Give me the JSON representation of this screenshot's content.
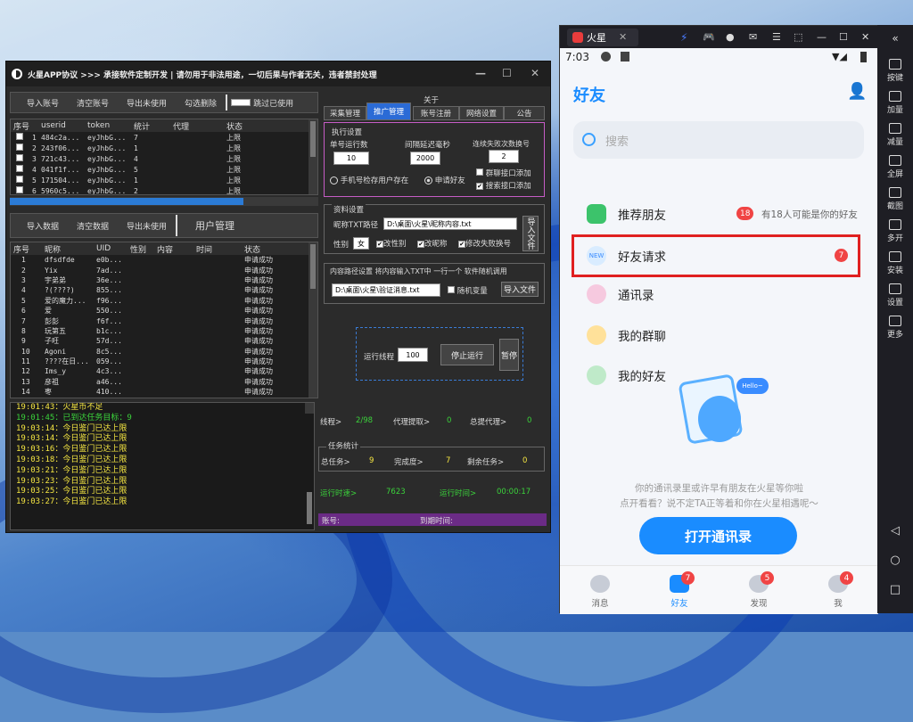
{
  "app": {
    "title": "火星APP协议  >>>  承接软件定制开发  |  请勿用于非法用途，一切后果与作者无关，违者禁封处理"
  },
  "toolbar1": [
    "导入账号",
    "清空账号",
    "导出未使用",
    "勾选删除"
  ],
  "skip_used": "跳过已使用",
  "acct_cols": [
    "序号",
    "userid",
    "token",
    "统计",
    "代理",
    "状态"
  ],
  "acct_rows": [
    [
      "1",
      "484c2a...",
      "eyJhbG...",
      "7",
      "",
      "上限"
    ],
    [
      "2",
      "243f06...",
      "eyJhbG...",
      "1",
      "",
      "上限"
    ],
    [
      "3",
      "721c43...",
      "eyJhbG...",
      "4",
      "",
      "上限"
    ],
    [
      "4",
      "041f1f...",
      "eyJhbG...",
      "5",
      "",
      "上限"
    ],
    [
      "5",
      "171504...",
      "eyJhbG...",
      "1",
      "",
      "上限"
    ],
    [
      "6",
      "5960c5...",
      "eyJhbG...",
      "2",
      "",
      "上限"
    ]
  ],
  "toolbar2": [
    "导入数据",
    "清空数据",
    "导出未使用"
  ],
  "user_mgmt": "用户管理",
  "user_cols": [
    "序号",
    "昵称",
    "UID",
    "性别",
    "内容",
    "时间",
    "状态"
  ],
  "user_rows": [
    [
      "1",
      "dfsdfde",
      "e0b...",
      "申请成功"
    ],
    [
      "2",
      "Yix",
      "7ad...",
      "申请成功"
    ],
    [
      "3",
      "宇弟弟",
      "36e...",
      "申请成功"
    ],
    [
      "4",
      "?(????)",
      "855...",
      "申请成功"
    ],
    [
      "5",
      "爱的魔力...",
      "f96...",
      "申请成功"
    ],
    [
      "6",
      "爱",
      "550...",
      "申请成功"
    ],
    [
      "7",
      "彭彭",
      "f6f...",
      "申请成功"
    ],
    [
      "8",
      "玩第五",
      "b1c...",
      "申请成功"
    ],
    [
      "9",
      "子旺",
      "57d...",
      "申请成功"
    ],
    [
      "10",
      "Agoni",
      "8c5...",
      "申请成功"
    ],
    [
      "11",
      "????在日...",
      "059...",
      "申请成功"
    ],
    [
      "12",
      "Ims_y",
      "4c3...",
      "申请成功"
    ],
    [
      "13",
      "彦祖",
      "a46...",
      "申请成功"
    ],
    [
      "14",
      "枣",
      "410...",
      "申请成功"
    ]
  ],
  "log": [
    {
      "t": "19:01:43",
      "m": "火星币不足",
      "c": "#f5e642"
    },
    {
      "t": "19:01:45",
      "m": "已到达任务目标：9",
      "c": "#3bd23b"
    },
    {
      "t": "19:03:14",
      "m": "今日鉴门已达上限",
      "c": "#f5e642"
    },
    {
      "t": "19:03:14",
      "m": "今日鉴门已达上限",
      "c": "#f5e642"
    },
    {
      "t": "19:03:16",
      "m": "今日鉴门已达上限",
      "c": "#f5e642"
    },
    {
      "t": "19:03:18",
      "m": "今日鉴门已达上限",
      "c": "#f5e642"
    },
    {
      "t": "19:03:21",
      "m": "今日鉴门已达上限",
      "c": "#f5e642"
    },
    {
      "t": "19:03:23",
      "m": "今日鉴门已达上限",
      "c": "#f5e642"
    },
    {
      "t": "19:03:25",
      "m": "今日鉴门已达上限",
      "c": "#f5e642"
    },
    {
      "t": "19:03:27",
      "m": "今日鉴门已达上限",
      "c": "#f5e642"
    }
  ],
  "tabs": {
    "about": "关于",
    "items": [
      "采集管理",
      "推广管理",
      "账号注册",
      "网络设置",
      "公告"
    ]
  },
  "exec": {
    "title": "执行设置",
    "single_count_label": "单号运行数",
    "single_count": "10",
    "interval_label": "间隔延迟毫秒",
    "interval": "2000",
    "fail_label": "连续失败次数换号",
    "fail": "2",
    "opt1": "手机号检存用户存在",
    "opt2": "申请好友",
    "chk1": "群聊接口添加",
    "chk2": "搜索接口添加"
  },
  "profile": {
    "title": "资料设置",
    "txt_label": "昵称TXT路径",
    "txt_path": "D:\\桌面\\火星\\昵称内容.txt",
    "import": "导入文件",
    "gender_label": "性别",
    "gender": "女",
    "c1": "改性别",
    "c2": "改昵称",
    "c3": "修改失败换号"
  },
  "content": {
    "title": "内容路径设置  将内容输入TXT中  一行一个  软件随机调用",
    "path": "D:\\桌面\\火星\\验证消息.txt",
    "rand": "随机变量",
    "import": "导入文件"
  },
  "run": {
    "threads_label": "运行线程",
    "threads": "100",
    "stop": "停止运行",
    "pause": "暂停"
  },
  "stats": {
    "thread_label": "线程>",
    "thread_val": "2/98",
    "proxy_label": "代理提取>",
    "proxy_val": "0",
    "total_proxy_label": "总提代理>",
    "total_proxy_val": "0",
    "group_title": "任务统计",
    "task_label": "总任务>",
    "task_val": "9",
    "done_label": "完成度>",
    "done_val": "7",
    "left_label": "剩余任务>",
    "left_val": "0",
    "speed_label": "运行时速>",
    "speed_val": "7623",
    "time_label": "运行时间>",
    "time_val": "00:00:17",
    "acct_label": "账号:",
    "expire_label": "到期时间:"
  },
  "emu": {
    "tab": "火星",
    "time": "7:03",
    "page_title": "好友",
    "search_placeholder": "搜索",
    "rows": [
      {
        "label": "推荐朋友",
        "badge": "18",
        "note": "有18人可能是你的好友"
      },
      {
        "label": "好友请求",
        "badge": "7"
      },
      {
        "label": "通讯录"
      },
      {
        "label": "我的群聊"
      },
      {
        "label": "我的好友"
      }
    ],
    "hello": "Hello~",
    "prompt1": "你的通讯录里或许早有朋友在火星等你啦",
    "prompt2": "点开看看？说不定TA正等着和你在火星相遇呢～",
    "open_btn": "打开通讯录",
    "nav": [
      {
        "label": "消息",
        "badge": ""
      },
      {
        "label": "好友",
        "badge": "7"
      },
      {
        "label": "发现",
        "badge": "5"
      },
      {
        "label": "我",
        "badge": "4"
      }
    ]
  },
  "side": [
    "按键",
    "加量",
    "减量",
    "全屏",
    "截图",
    "多开",
    "安装",
    "设置",
    "更多"
  ]
}
